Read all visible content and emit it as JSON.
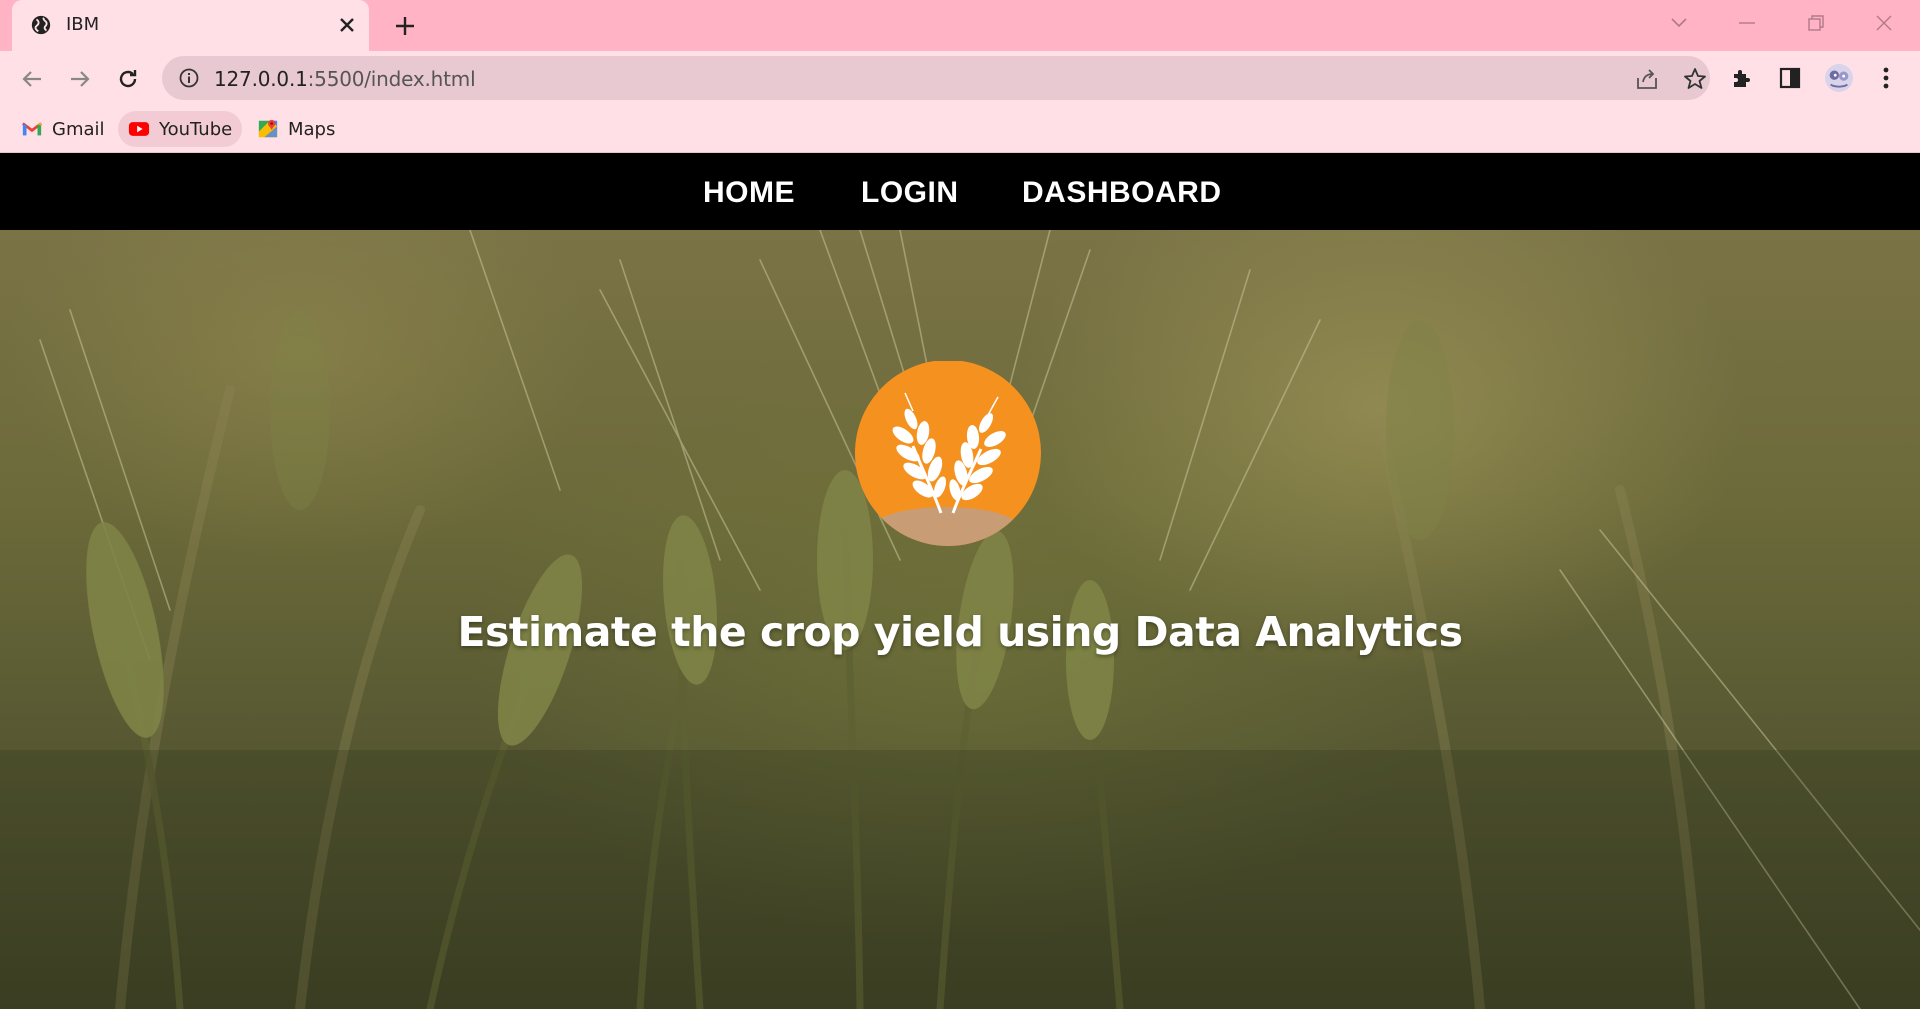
{
  "browser": {
    "tab": {
      "title": "IBM",
      "favicon": "globe-icon"
    },
    "address_bar": {
      "host": "127.0.0.1",
      "path": ":5500/index.html"
    },
    "bookmarks": [
      {
        "label": "Gmail",
        "icon": "gmail-icon"
      },
      {
        "label": "YouTube",
        "icon": "youtube-icon"
      },
      {
        "label": "Maps",
        "icon": "maps-icon"
      }
    ],
    "colors": {
      "tabstrip": "#ffb3c4",
      "toolbar": "#ffe0e7",
      "omnibox": "#e9c9d1"
    }
  },
  "site": {
    "nav": [
      {
        "label": "HOME"
      },
      {
        "label": "LOGIN"
      },
      {
        "label": "DASHBOARD"
      }
    ],
    "hero": {
      "logo": "wheat-logo-icon",
      "headline": "Estimate the crop yield using Data Analytics"
    },
    "colors": {
      "nav_bg": "#000000",
      "logo_circle": "#f5921f",
      "logo_soil": "#c89d76"
    }
  }
}
